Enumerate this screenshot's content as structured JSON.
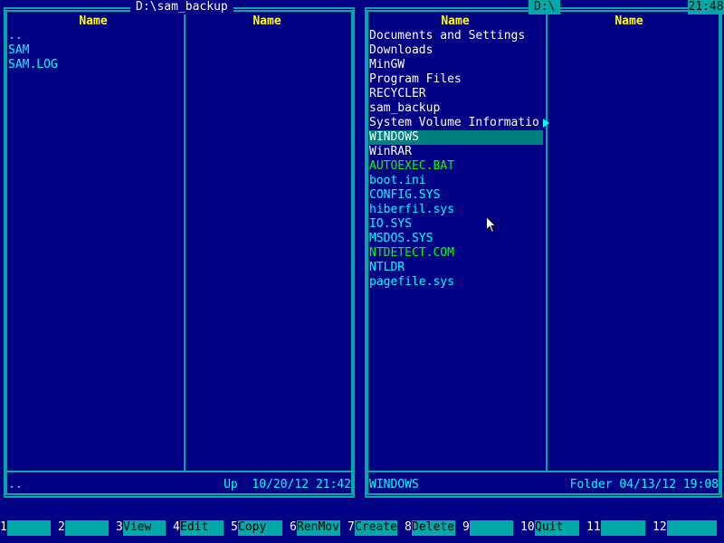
{
  "clock": "21:48",
  "left_panel": {
    "path": "D:\\sam_backup",
    "columns": [
      "Name",
      "Name"
    ],
    "col1_files": [
      {
        "name": "..",
        "color": "#00ffff"
      },
      {
        "name": "SAM",
        "color": "#00ffff"
      },
      {
        "name": "SAM.LOG",
        "color": "#00ffff"
      }
    ],
    "col2_files": [],
    "status_name": "..",
    "status_info": "Up  10/20/12 21:42"
  },
  "right_panel": {
    "path": "D:\\",
    "columns": [
      "Name",
      "Name"
    ],
    "col1_files": [
      {
        "name": "Documents and Settings",
        "color": "#ffffff"
      },
      {
        "name": "Downloads",
        "color": "#ffffff"
      },
      {
        "name": "MinGW",
        "color": "#ffffff"
      },
      {
        "name": "Program Files",
        "color": "#ffffff"
      },
      {
        "name": "RECYCLER",
        "color": "#ffffff"
      },
      {
        "name": "sam_backup",
        "color": "#ffffff"
      },
      {
        "name": "System Volume Informatio",
        "color": "#ffffff"
      },
      {
        "name": "WINDOWS",
        "color": "#ffffff",
        "selected": true
      },
      {
        "name": "WinRAR",
        "color": "#ffffff"
      },
      {
        "name": "AUTOEXEC.BAT",
        "color": "#00ff00"
      },
      {
        "name": "boot.ini",
        "color": "#00ffff"
      },
      {
        "name": "CONFIG.SYS",
        "color": "#00ffff"
      },
      {
        "name": "hiberfil.sys",
        "color": "#00ffff"
      },
      {
        "name": "IO.SYS",
        "color": "#00ffff"
      },
      {
        "name": "MSDOS.SYS",
        "color": "#00ffff"
      },
      {
        "name": "NTDETECT.COM",
        "color": "#00ff00"
      },
      {
        "name": "NTLDR",
        "color": "#00ffff"
      },
      {
        "name": "pagefile.sys",
        "color": "#00ffff"
      }
    ],
    "col2_files": [],
    "status_name": "WINDOWS",
    "status_info": "Folder 04/13/12 19:08"
  },
  "keybar": [
    {
      "num": "1",
      "label": ""
    },
    {
      "num": "2",
      "label": ""
    },
    {
      "num": "3",
      "label": "View"
    },
    {
      "num": "4",
      "label": "Edit"
    },
    {
      "num": "5",
      "label": "Copy"
    },
    {
      "num": "6",
      "label": "RenMov"
    },
    {
      "num": "7",
      "label": "Create"
    },
    {
      "num": "8",
      "label": "Delete"
    },
    {
      "num": "9",
      "label": ""
    },
    {
      "num": "10",
      "label": "Quit"
    },
    {
      "num": "11",
      "label": ""
    },
    {
      "num": "12",
      "label": ""
    }
  ]
}
